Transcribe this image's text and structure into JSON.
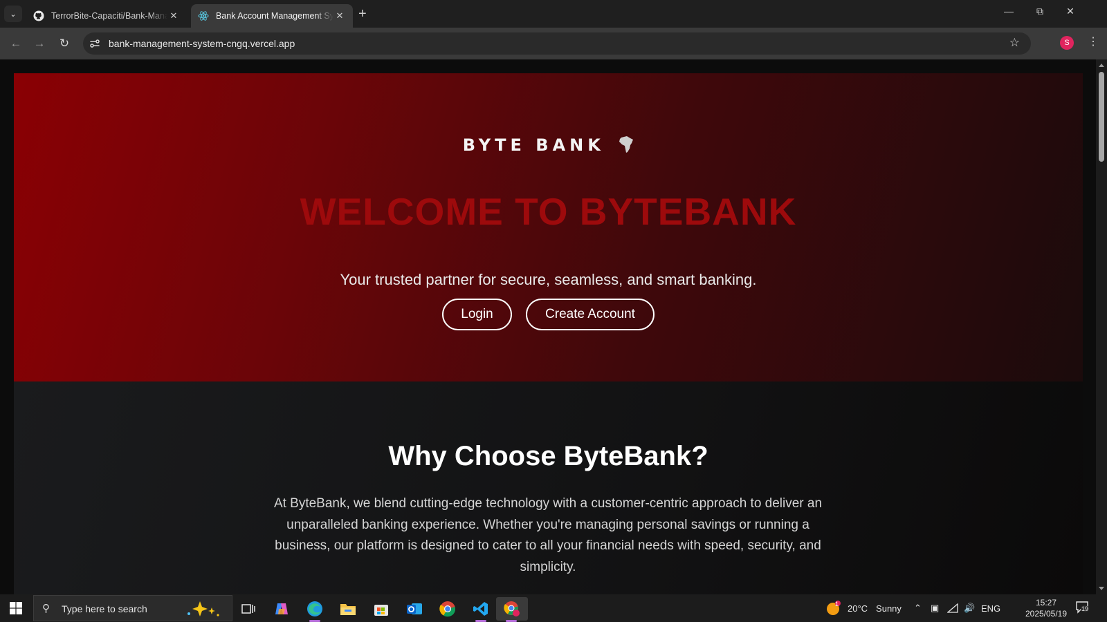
{
  "browser": {
    "tabs": [
      {
        "title": "TerrorBite-Capaciti/Bank-Management-System",
        "favicon": "github-icon",
        "active": false
      },
      {
        "title": "Bank Account Management System",
        "favicon": "react-icon",
        "active": true
      }
    ],
    "url": "bank-management-system-cngq.vercel.app",
    "profile_initial": "S"
  },
  "hero": {
    "logo_text": "BYTE BANK",
    "heading": "WELCOME TO BYTEBANK",
    "tagline": "Your trusted partner for secure, seamless, and smart banking.",
    "login_label": "Login",
    "create_label": "Create Account"
  },
  "why": {
    "heading": "Why Choose ByteBank?",
    "body": "At ByteBank, we blend cutting-edge technology with a customer-centric approach to deliver an unparalleled banking experience. Whether you're managing personal savings or running a business, our platform is designed to cater to all your financial needs with speed, security, and simplicity."
  },
  "taskbar": {
    "search_placeholder": "Type here to search",
    "weather_temp": "20°C",
    "weather_text": "Sunny",
    "weather_badge": "1",
    "language": "ENG",
    "time": "15:27",
    "date": "2025/05/19",
    "notification_count": "19"
  },
  "colors": {
    "hero_red": "#8a0004",
    "heading_red": "#9d0a0c",
    "chrome_dark": "#1f1f1f",
    "profile_pink": "#e0245e"
  }
}
